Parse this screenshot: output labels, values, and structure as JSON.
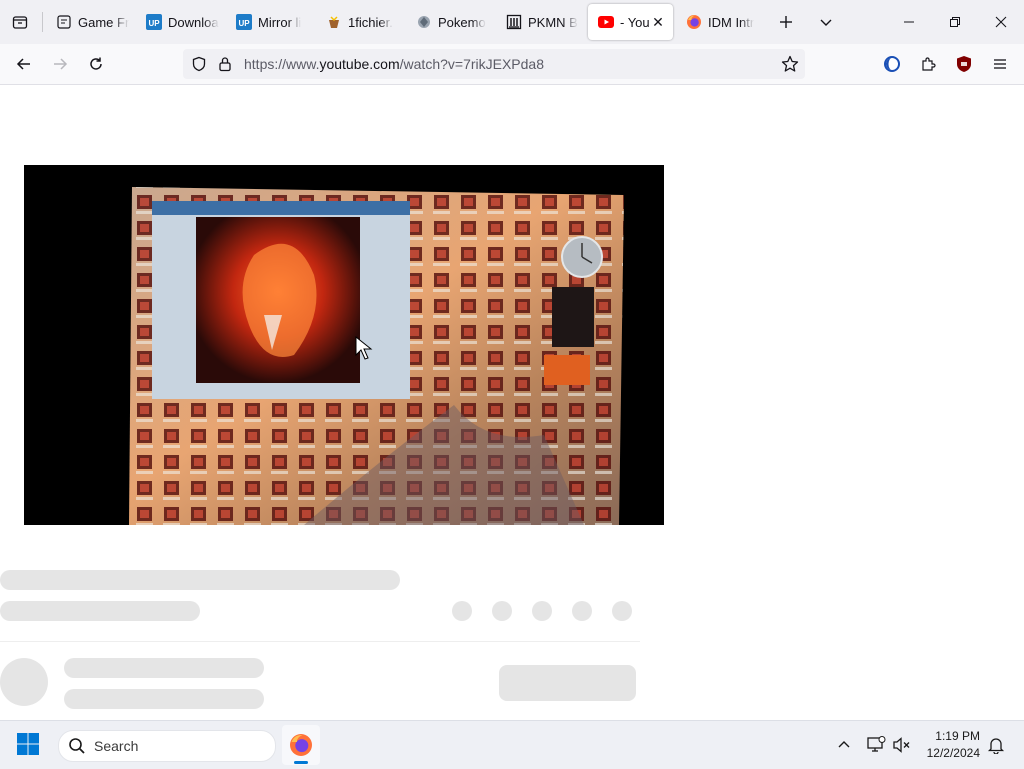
{
  "tabs": [
    {
      "label": "Game Fr",
      "icon": "document-icon",
      "active": false
    },
    {
      "label": "Downloa",
      "icon": "uptobox-icon",
      "active": false
    },
    {
      "label": "Mirror li",
      "icon": "uptobox-icon",
      "active": false
    },
    {
      "label": "1fichier.",
      "icon": "1fichier-icon",
      "active": false
    },
    {
      "label": "Pokemo",
      "icon": "pokemon-icon",
      "active": false
    },
    {
      "label": "PKMN B",
      "icon": "archive-icon",
      "active": false
    },
    {
      "label": "- You",
      "icon": "youtube-icon",
      "active": true
    },
    {
      "label": "IDM Intr",
      "icon": "firefox-icon",
      "active": false
    }
  ],
  "tab_close_symbol": "✕",
  "favicon_letters": {
    "uptobox": "UP"
  },
  "url": {
    "scheme": "https://www.",
    "host": "youtube.com",
    "path": "/watch?v=7rikJEXPda8"
  },
  "taskbar": {
    "search_label": "Search",
    "time": "1:19 PM",
    "date": "12/2/2024"
  },
  "colors": {
    "youtube_red": "#ff0000",
    "uptobox_blue": "#1e7cc8",
    "firefox_orange": "#ff7139",
    "firefox_purple": "#7542e5",
    "windows_blue": "#0078d4",
    "ublock_red": "#800000"
  }
}
